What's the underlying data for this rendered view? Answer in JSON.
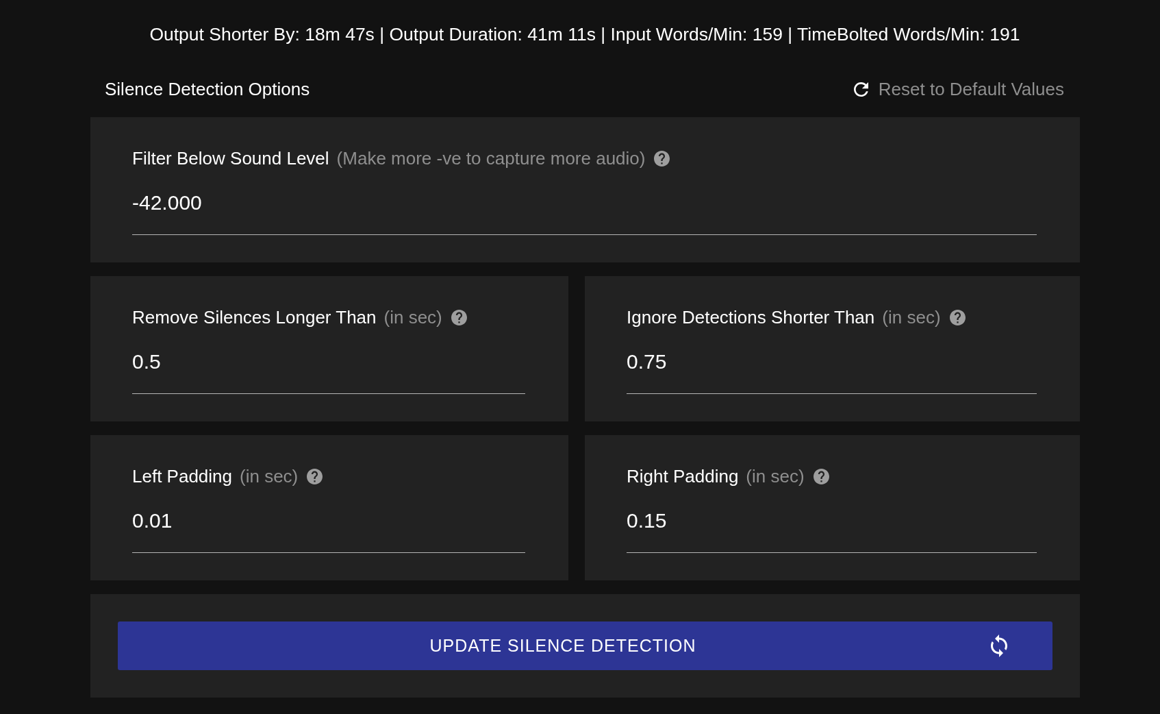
{
  "summary": "Output Shorter By: 18m 47s | Output Duration: 41m 11s | Input Words/Min: 159 | TimeBolted Words/Min: 191",
  "options": {
    "title": "Silence Detection Options",
    "reset_link": "Reset to Default Values"
  },
  "field_rows": [
    {
      "fields": [
        {
          "label": "Filter Below Sound Level",
          "hint": "(Make more -ve to capture more audio)",
          "value": "-42.000"
        }
      ]
    },
    {
      "fields": [
        {
          "label": "Remove Silences Longer Than",
          "hint": "(in sec)",
          "value": "0.5"
        },
        {
          "label": "Ignore Detections Shorter Than",
          "hint": "(in sec)",
          "value": "0.75"
        }
      ]
    },
    {
      "fields": [
        {
          "label": "Left Padding",
          "hint": "(in sec)",
          "value": "0.01"
        },
        {
          "label": "Right Padding",
          "hint": "(in sec)",
          "value": "0.15"
        }
      ]
    }
  ],
  "update_button": {
    "label": "UPDATE SILENCE DETECTION"
  }
}
